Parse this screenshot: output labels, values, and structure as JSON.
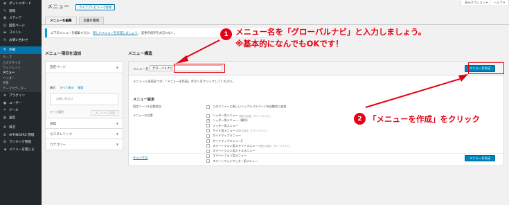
{
  "sidebar": {
    "items": [
      {
        "icon": "dashboard-icon",
        "glyph": "◉",
        "label": "ダッシュボード"
      },
      {
        "icon": "pin-icon",
        "glyph": "✎",
        "label": "投稿"
      },
      {
        "icon": "media-icon",
        "glyph": "▣",
        "label": "メディア"
      },
      {
        "icon": "page-icon",
        "glyph": "▤",
        "label": "固定ページ"
      },
      {
        "icon": "comment-icon",
        "glyph": "▬",
        "label": "コメント"
      },
      {
        "icon": "mail-icon",
        "glyph": "✉",
        "label": "お問い合わせ"
      }
    ],
    "active": {
      "icon": "appearance-icon",
      "glyph": "✎",
      "label": "外観"
    },
    "submenu": [
      "テーマ",
      "カスタマイズ",
      "ウィジェット",
      "メニュー",
      "ヘッダー",
      "背景",
      "テーマエディター"
    ],
    "current_sub": "メニュー",
    "items_after": [
      {
        "icon": "plugin-icon",
        "glyph": "✚",
        "label": "プラグイン"
      },
      {
        "icon": "user-icon",
        "glyph": "●",
        "label": "ユーザー"
      },
      {
        "icon": "tool-icon",
        "glyph": "✦",
        "label": "ツール"
      },
      {
        "icon": "settings-icon",
        "glyph": "▦",
        "label": "設定"
      }
    ],
    "items_last": [
      {
        "icon": "gear-icon",
        "glyph": "✿",
        "label": "目次"
      },
      {
        "icon": "gear-icon",
        "glyph": "✿",
        "label": "AFFINGER5 管理"
      },
      {
        "icon": "gear-icon",
        "glyph": "✿",
        "label": "ランキング管理"
      },
      {
        "icon": "collapse-icon",
        "glyph": "◀",
        "label": "メニューを閉じる"
      }
    ]
  },
  "header": {
    "title": "メニュー",
    "preview_button": "ライブプレビューで管理",
    "screen_options": "表示オプション ▾",
    "help": "ヘルプ ▾"
  },
  "tabs": [
    {
      "label": "メニューを編集",
      "active": true
    },
    {
      "label": "位置を管理",
      "active": false
    }
  ],
  "notice": {
    "prefix": "以下のメニューを編集するか、",
    "link": "新しいメニューを作成しましょう",
    "suffix": "。変更の保存をお忘れなく。"
  },
  "left": {
    "heading": "メニュー項目を追加",
    "sections": [
      "固定ページ",
      "投稿",
      "カスタムリンク",
      "カテゴリー"
    ],
    "mini_tabs": [
      "最近",
      "すべて表示",
      "検索"
    ],
    "item": "お問い合わせ",
    "select_all": "すべて選択",
    "add_button": "メニューに追加"
  },
  "right": {
    "heading": "メニュー構造",
    "name_label": "メニュー名",
    "name_value": "グローバルナビ",
    "create_button": "メニューを作成",
    "instruction": "メニューに名前をつけ、「メニューを作成」ボタンをクリックしてください。",
    "settings_title": "メニュー設定",
    "auto_add_label": "固定ページを自動追加",
    "auto_add_option": "このメニューに新しいトップレベルページを自動的に追加",
    "location_label": "メニューの位置",
    "locations": [
      {
        "label": "ヘッダー用メニュー",
        "note": "(現在の設定: グローバルナビ)",
        "checked": false
      },
      {
        "label": "ヘッダー用メニュー（横列）",
        "note": "",
        "checked": true
      },
      {
        "label": "フッター用メニュー",
        "note": "",
        "checked": false
      },
      {
        "label": "サイド用メニュー",
        "note": "(現在の設定: グローバルナビ)",
        "checked": false
      },
      {
        "label": "ガイドマップメニュー",
        "note": "",
        "checked": false
      },
      {
        "label": "ガイドマップメニュー2",
        "note": "",
        "checked": false
      },
      {
        "label": "スマートフォン用スライドメニュー",
        "note": "(現在の設定: グローバルナビ)",
        "checked": false
      },
      {
        "label": "スマートフォン用ミドルメニュー",
        "note": "",
        "checked": false
      },
      {
        "label": "スマートフォン用メニュー",
        "note": "",
        "checked": false
      },
      {
        "label": "スマートフォンフッター用メニュー",
        "note": "",
        "checked": false
      }
    ],
    "cancel": "キャンセル",
    "create_button_bottom": "メニューを作成"
  },
  "annotations": {
    "step1_number": "1",
    "step1_line1": "メニュー名を「グローバルナビ」と入力しましょう。",
    "step1_line2": "※基本的になんでもOKです！",
    "step2_number": "2",
    "step2_text": "「メニューを作成」をクリック",
    "color": "#e60012"
  }
}
